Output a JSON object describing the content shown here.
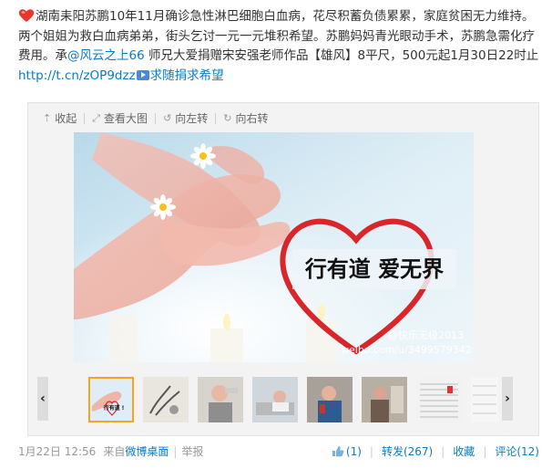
{
  "post": {
    "text_1": "湖南耒阳苏鹏10年11月确诊急性淋巴细胞白血病，花尽积蓄负债累累，家庭贫困无力维持。两个姐姐为救白血病弟弟，街头乞讨一元一元堆积希望。苏鹏妈妈青光眼动手术，苏鹏急需化疗费用。承",
    "mention": "@风云之上66",
    "text_2": " 师兄大爱捐赠宋安强老师作品【雄风】8平尺，500元起1月30日22时止",
    "url": "http://t.cn/zOP9dzz",
    "text_3": "求随捐求希望"
  },
  "toolbar": {
    "collapse": "收起",
    "view_large": "查看大图",
    "rotate_left": "向左转",
    "rotate_right": "向右转"
  },
  "image": {
    "slogan": "行有道 爱无界",
    "watermark_1": "@快乐无极2013",
    "watermark_2": "weibo.com/u/3499579342"
  },
  "thumbs": {
    "count": 8,
    "selected_index": 0,
    "first_thumb_text": "行有道 !"
  },
  "footer": {
    "time": "1月22日 12:56",
    "source_prefix": "来自",
    "source": "微博桌面",
    "report": "举报",
    "like_count": "(1)",
    "repost": "转发(267)",
    "favorite": "收藏",
    "comment": "评论(12)"
  },
  "colors": {
    "link": "#0a7bc5",
    "heart": "#e8362e",
    "selected": "#f8a418"
  },
  "icons": [
    "heart-icon",
    "video-icon",
    "collapse-icon",
    "view-large-icon",
    "rotate-left-icon",
    "rotate-right-icon",
    "thumb-up-icon",
    "chevron-left-icon",
    "chevron-right-icon"
  ]
}
